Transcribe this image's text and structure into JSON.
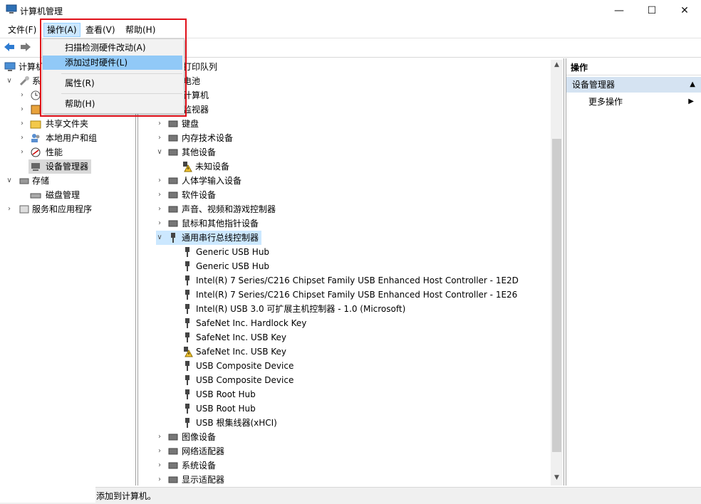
{
  "window": {
    "title": "计算机管理",
    "minimize": "—",
    "maximize": "☐",
    "close": "✕"
  },
  "menubar": {
    "items": [
      {
        "label": "文件(F)"
      },
      {
        "label": "操作(A)"
      },
      {
        "label": "查看(V)"
      },
      {
        "label": "帮助(H)"
      }
    ]
  },
  "dropdown": {
    "items": [
      {
        "label": "扫描检测硬件改动(A)"
      },
      {
        "label": "添加过时硬件(L)"
      },
      {
        "label": "属性(R)"
      },
      {
        "label": "帮助(H)"
      }
    ]
  },
  "left_tree": {
    "root": "计算机",
    "system_partial": "系",
    "items": [
      {
        "label": "共享文件夹"
      },
      {
        "label": "本地用户和组"
      },
      {
        "label": "性能"
      },
      {
        "label": "设备管理器"
      },
      {
        "label": "存储"
      },
      {
        "label": "磁盘管理"
      },
      {
        "label": "服务和应用程序"
      }
    ]
  },
  "device_tree": {
    "partial_top": [
      "打印队列",
      "电池",
      "计算机",
      "监视器"
    ],
    "categories": [
      {
        "label": "键盘"
      },
      {
        "label": "内存技术设备"
      },
      {
        "label": "其他设备"
      },
      {
        "label": "未知设备"
      },
      {
        "label": "人体学输入设备"
      },
      {
        "label": "软件设备"
      },
      {
        "label": "声音、视频和游戏控制器"
      },
      {
        "label": "鼠标和其他指针设备"
      },
      {
        "label": "通用串行总线控制器"
      }
    ],
    "usb_devices": [
      {
        "label": "Generic USB Hub"
      },
      {
        "label": "Generic USB Hub"
      },
      {
        "label": "Intel(R) 7 Series/C216 Chipset Family USB Enhanced Host Controller - 1E2D"
      },
      {
        "label": "Intel(R) 7 Series/C216 Chipset Family USB Enhanced Host Controller - 1E26"
      },
      {
        "label": "Intel(R) USB 3.0 可扩展主机控制器 - 1.0 (Microsoft)"
      },
      {
        "label": "SafeNet Inc. Hardlock Key"
      },
      {
        "label": "SafeNet Inc. USB Key"
      },
      {
        "label": "SafeNet Inc. USB Key"
      },
      {
        "label": "USB Composite Device"
      },
      {
        "label": "USB Composite Device"
      },
      {
        "label": "USB Root Hub"
      },
      {
        "label": "USB Root Hub"
      },
      {
        "label": "USB 根集线器(xHCI)"
      }
    ],
    "bottom": [
      {
        "label": "图像设备"
      },
      {
        "label": "网络适配器"
      },
      {
        "label": "系统设备"
      },
      {
        "label": "显示适配器"
      }
    ]
  },
  "actions_pane": {
    "header": "操作",
    "section": "设备管理器",
    "more": "更多操作"
  },
  "statusbar": {
    "text": "添加到计算机。"
  },
  "colors": {
    "highlight_border": "#e0101a",
    "selected_bg": "#cce8ff",
    "menu_hover": "#91c9f7"
  }
}
